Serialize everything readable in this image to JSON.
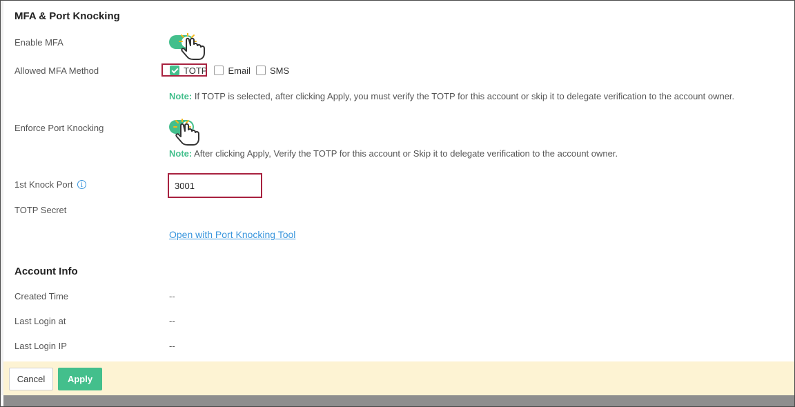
{
  "mfa_section": {
    "title": "MFA & Port Knocking",
    "enable_mfa_label": "Enable MFA",
    "enable_mfa_on": true,
    "allowed_method_label": "Allowed MFA Method",
    "methods": [
      {
        "label": "TOTP",
        "checked": true
      },
      {
        "label": "Email",
        "checked": false
      },
      {
        "label": "SMS",
        "checked": false
      }
    ],
    "note1_label": "Note:",
    "note1_text": " If TOTP is selected, after clicking Apply, you must verify the TOTP for this account or skip it to delegate verification to the account owner.",
    "enforce_port_knocking_label": "Enforce Port Knocking",
    "enforce_port_knocking_on": true,
    "note2_label": "Note:",
    "note2_text": " After clicking Apply, Verify the TOTP for this account or Skip it to delegate verification to the account owner.",
    "knock_port_label": "1st Knock Port",
    "knock_port_value": "3001",
    "totp_secret_label": "TOTP Secret",
    "port_knocking_link": "Open with Port Knocking Tool"
  },
  "account_section": {
    "title": "Account Info",
    "rows": [
      {
        "label": "Created Time",
        "value": "--"
      },
      {
        "label": "Last Login at",
        "value": "--"
      },
      {
        "label": "Last Login IP",
        "value": "--"
      }
    ]
  },
  "footer": {
    "cancel_label": "Cancel",
    "apply_label": "Apply"
  },
  "colors": {
    "accent": "#43bf8c",
    "highlight": "#a8213f",
    "link": "#3a96dd",
    "footer_bg": "#fdf3d3"
  },
  "icons": {
    "info": "info-icon",
    "cursor": "hand-pointer-icon"
  }
}
